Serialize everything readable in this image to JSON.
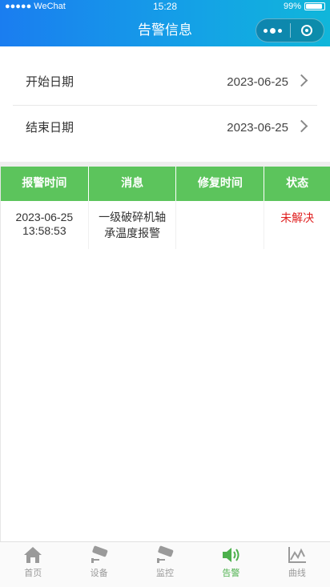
{
  "statusbar": {
    "carrier": "●●●●● WeChat",
    "time": "15:28",
    "battery": "99%"
  },
  "header": {
    "title": "告警信息"
  },
  "filters": {
    "start_label": "开始日期",
    "start_value": "2023-06-25",
    "end_label": "结束日期",
    "end_value": "2023-06-25"
  },
  "table": {
    "headers": [
      "报警时间",
      "消息",
      "修复时间",
      "状态"
    ],
    "rows": [
      {
        "alarm_time": "2023-06-25\n13:58:53",
        "message": "一级破碎机轴承温度报警",
        "repair_time": "",
        "status": "未解决"
      }
    ]
  },
  "tabbar": {
    "items": [
      {
        "label": "首页",
        "icon": "home-icon"
      },
      {
        "label": "设备",
        "icon": "camera-icon"
      },
      {
        "label": "监控",
        "icon": "camera-icon"
      },
      {
        "label": "告警",
        "icon": "speaker-icon"
      },
      {
        "label": "曲线",
        "icon": "chart-icon"
      }
    ],
    "active_index": 3
  },
  "colors": {
    "accent": "#5cc45c",
    "header_start": "#1a7df0",
    "header_end": "#10b6da",
    "status_unresolved": "#e02020"
  }
}
